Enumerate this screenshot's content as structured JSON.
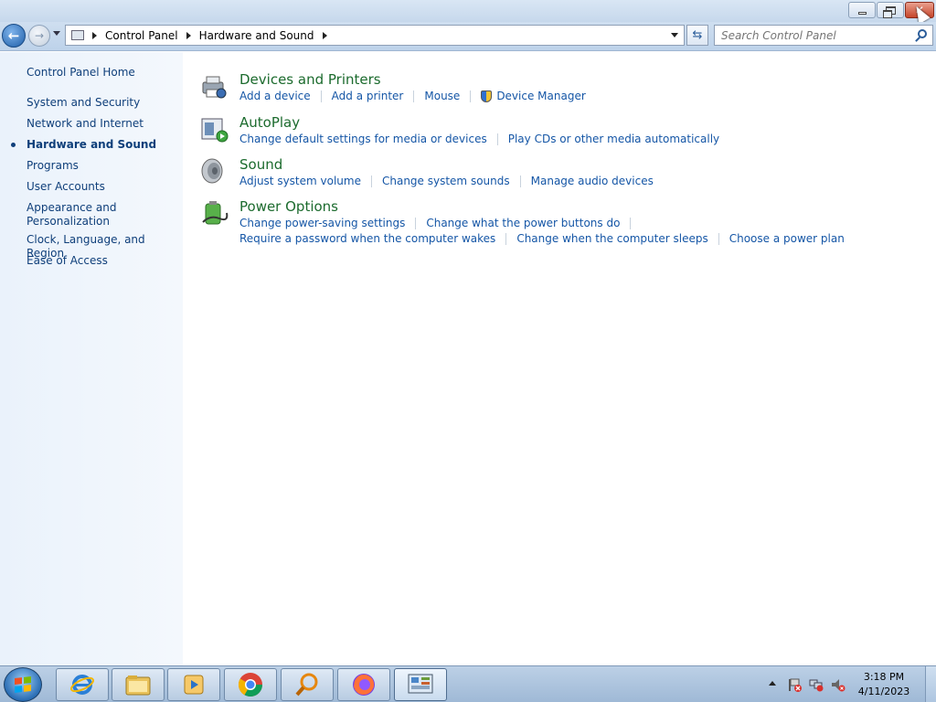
{
  "window": {
    "controls": {
      "minimize": "minimize",
      "restore": "restore",
      "close": "close"
    }
  },
  "nav": {
    "breadcrumb": [
      "Control Panel",
      "Hardware and Sound"
    ],
    "search_placeholder": "Search Control Panel"
  },
  "sidebar": {
    "items": [
      {
        "label": "Control Panel Home",
        "active": false
      },
      {
        "label": "System and Security",
        "active": false
      },
      {
        "label": "Network and Internet",
        "active": false
      },
      {
        "label": "Hardware and Sound",
        "active": true
      },
      {
        "label": "Programs",
        "active": false
      },
      {
        "label": "User Accounts",
        "active": false
      },
      {
        "label": "Appearance and Personalization",
        "active": false
      },
      {
        "label": "Clock, Language, and Region",
        "active": false
      },
      {
        "label": "Ease of Access",
        "active": false
      }
    ]
  },
  "categories": [
    {
      "title": "Devices and Printers",
      "links": [
        "Add a device",
        "Add a printer",
        "Mouse",
        "Device Manager"
      ]
    },
    {
      "title": "AutoPlay",
      "links": [
        "Change default settings for media or devices",
        "Play CDs or other media automatically"
      ]
    },
    {
      "title": "Sound",
      "links": [
        "Adjust system volume",
        "Change system sounds",
        "Manage audio devices"
      ]
    },
    {
      "title": "Power Options",
      "links": [
        "Change power-saving settings",
        "Change what the power buttons do"
      ],
      "links2": [
        "Require a password when the computer wakes",
        "Change when the computer sleeps",
        "Choose a power plan"
      ]
    }
  ],
  "taskbar": {
    "apps": [
      "internet-explorer",
      "windows-explorer",
      "media-player",
      "chrome",
      "search-tool",
      "firefox",
      "control-panel"
    ],
    "clock": {
      "time": "3:18 PM",
      "date": "4/11/2023"
    }
  },
  "colors": {
    "category_title": "#1c6b2e",
    "link": "#1556a6",
    "sidebar_link": "#0f3f7a"
  }
}
